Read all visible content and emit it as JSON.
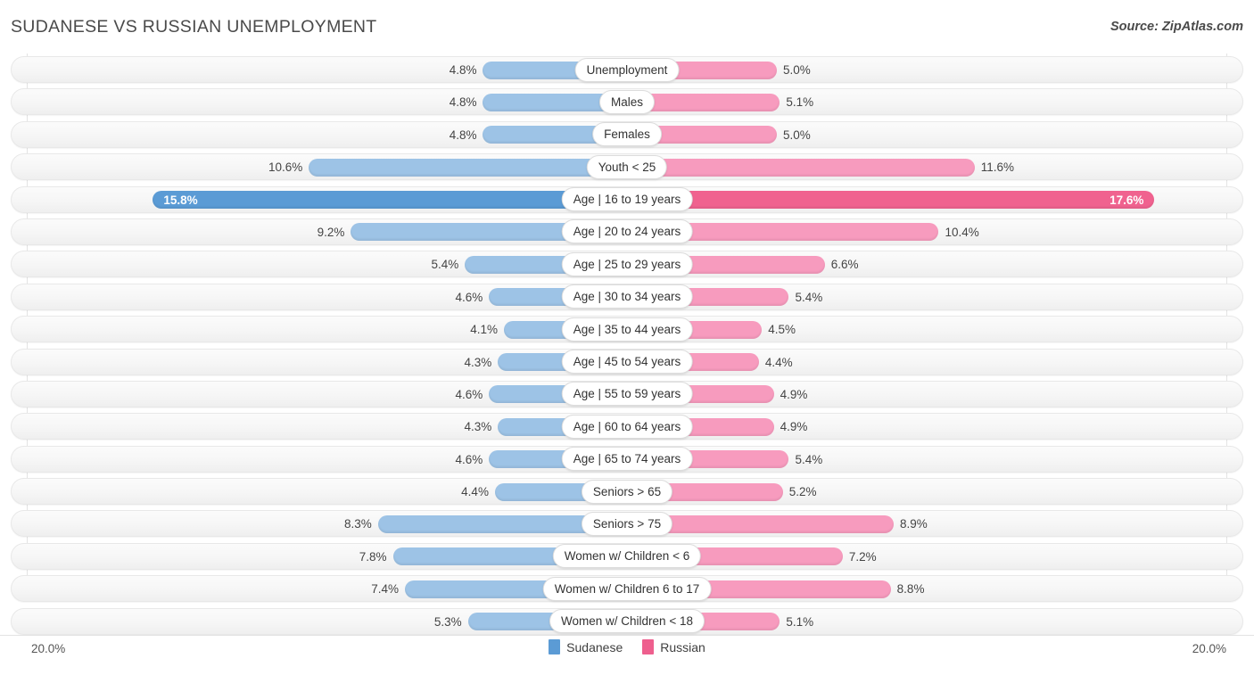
{
  "header": {
    "title": "SUDANESE VS RUSSIAN UNEMPLOYMENT",
    "source": "Source: ZipAtlas.com"
  },
  "legend": {
    "items": [
      {
        "label": "Sudanese",
        "color": "#5B9BD5"
      },
      {
        "label": "Russian",
        "color": "#EE5F8E"
      }
    ]
  },
  "axis": {
    "left_label": "20.0%",
    "right_label": "20.0%"
  },
  "colors": {
    "left_bar": "#9DC3E6",
    "left_bar_max": "#5B9BD5",
    "right_bar": "#F79BBE",
    "right_bar_max": "#F0628F",
    "track": "#F6F6F6",
    "text": "#444444"
  },
  "chart_data": {
    "type": "bar",
    "title": "SUDANESE VS RUSSIAN UNEMPLOYMENT",
    "subtitle": "",
    "xlabel": "",
    "ylabel": "",
    "orientation": "horizontal-diverging",
    "xlim": [
      0,
      20.0
    ],
    "axis_max": 20.0,
    "grid": false,
    "legend_position": "bottom-center",
    "categories": [
      "Unemployment",
      "Males",
      "Females",
      "Youth < 25",
      "Age | 16 to 19 years",
      "Age | 20 to 24 years",
      "Age | 25 to 29 years",
      "Age | 30 to 34 years",
      "Age | 35 to 44 years",
      "Age | 45 to 54 years",
      "Age | 55 to 59 years",
      "Age | 60 to 64 years",
      "Age | 65 to 74 years",
      "Seniors > 65",
      "Seniors > 75",
      "Women w/ Children < 6",
      "Women w/ Children 6 to 17",
      "Women w/ Children < 18"
    ],
    "series": [
      {
        "name": "Sudanese",
        "color": "#9DC3E6",
        "values": [
          4.8,
          4.8,
          4.8,
          10.6,
          15.8,
          9.2,
          5.4,
          4.6,
          4.1,
          4.3,
          4.6,
          4.3,
          4.6,
          4.4,
          8.3,
          7.8,
          7.4,
          5.3
        ],
        "labels": [
          "4.8%",
          "4.8%",
          "4.8%",
          "10.6%",
          "15.8%",
          "9.2%",
          "5.4%",
          "4.6%",
          "4.1%",
          "4.3%",
          "4.6%",
          "4.3%",
          "4.6%",
          "4.4%",
          "8.3%",
          "7.8%",
          "7.4%",
          "5.3%"
        ]
      },
      {
        "name": "Russian",
        "color": "#F79BBE",
        "values": [
          5.0,
          5.1,
          5.0,
          11.6,
          17.6,
          10.4,
          6.6,
          5.4,
          4.5,
          4.4,
          4.9,
          4.9,
          5.4,
          5.2,
          8.9,
          7.2,
          8.8,
          5.1
        ],
        "labels": [
          "5.0%",
          "5.1%",
          "5.0%",
          "11.6%",
          "17.6%",
          "10.4%",
          "6.6%",
          "5.4%",
          "4.5%",
          "4.4%",
          "4.9%",
          "4.9%",
          "5.4%",
          "5.2%",
          "8.9%",
          "7.2%",
          "8.8%",
          "5.1%"
        ]
      }
    ],
    "highlight_row_index": 4
  }
}
